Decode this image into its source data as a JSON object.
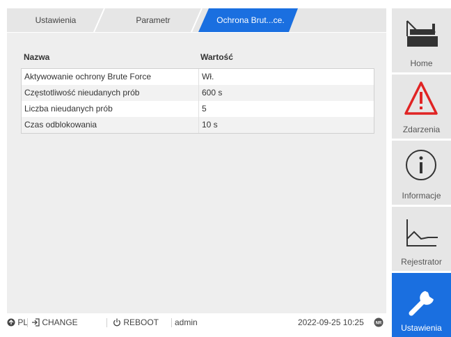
{
  "breadcrumb": {
    "items": [
      "Ustawienia",
      "Parametr",
      "Ochrona Brut...ce."
    ],
    "active_color": "#1a6fe0"
  },
  "table": {
    "headers": {
      "name": "Nazwa",
      "value": "Wartość"
    },
    "rows": [
      {
        "name": "Aktywowanie ochrony Brute Force",
        "value": "Wł."
      },
      {
        "name": "Częstotliwość nieudanych prób",
        "value": "600 s"
      },
      {
        "name": "Liczba nieudanych prób",
        "value": "5"
      },
      {
        "name": "Czas odblokowania",
        "value": "10 s"
      }
    ]
  },
  "status": {
    "language": "PL",
    "change_label": "CHANGE",
    "reboot_label": "REBOOT",
    "user": "admin",
    "datetime": "2022-09-25 10:25"
  },
  "nav": {
    "items": [
      {
        "label": "Home",
        "icon": "home-router-icon"
      },
      {
        "label": "Zdarzenia",
        "icon": "warning-icon"
      },
      {
        "label": "Informacje",
        "icon": "info-icon"
      },
      {
        "label": "Rejestrator",
        "icon": "graph-icon"
      },
      {
        "label": "Ustawienia",
        "icon": "wrench-icon"
      }
    ],
    "active": "Ustawienia",
    "colors": {
      "warning": "#e02424",
      "active_bg": "#1a6fe0"
    }
  }
}
